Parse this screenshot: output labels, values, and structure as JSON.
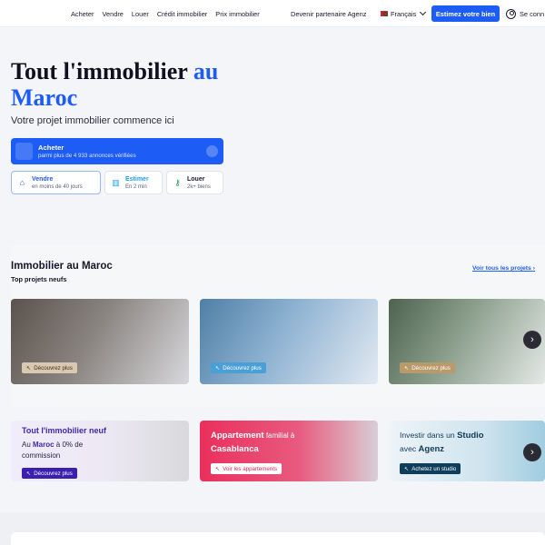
{
  "nav": {
    "links": [
      "Acheter",
      "Vendre",
      "Louer",
      "Crédit immobilier",
      "Prix immobilier"
    ],
    "partner": "Devenir partenaire Agenz",
    "language": "Français",
    "estimate_button": "Estimez votre bien",
    "login": "Se conn"
  },
  "hero": {
    "title_main": "Tout l'immobilier ",
    "title_accent_1": "au",
    "title_accent_2": "Maroc",
    "subtitle": "Votre projet immobilier commence ici",
    "buy": {
      "label": "Acheter",
      "detail": "parmi plus de 4 933 annonces vérifiées"
    },
    "sell": {
      "label": "Vendre",
      "detail": "en moins de 40 jours"
    },
    "estimate": {
      "label": "Estimer",
      "detail": "En 2 min"
    },
    "rent": {
      "label": "Louer",
      "detail": "2k+ biens"
    }
  },
  "projects": {
    "title": "Immobilier au Maroc",
    "subtitle": "Top projets neufs",
    "see_all": "Voir tous les projets",
    "cards": [
      {
        "cta": "Découvrez plus"
      },
      {
        "cta": "Découvrez plus"
      },
      {
        "cta": "Découvrez plus"
      }
    ]
  },
  "promos": {
    "new": {
      "headline": "Tout l'immobilier neuf",
      "line1_pre": "Au ",
      "line1_bold": "Maroc",
      "line1_post": " à 0% de",
      "line2": "commission",
      "cta": "Découvrez plus"
    },
    "family": {
      "headline_bold": "Appartement",
      "headline_rest": " familial à",
      "city": "Casablanca",
      "cta": "Voir les appartements"
    },
    "studio": {
      "line1_pre": "Investir dans un ",
      "line1_bold": "Studio",
      "line2_pre": "avec ",
      "line2_bold": "Agenz",
      "cta": "Achetez un studio"
    }
  },
  "colors": {
    "primary": "#1d5cf5",
    "promo_purple": "#3f2aa8",
    "promo_pink": "#ea2f5c",
    "promo_navy": "#0e3e5c"
  }
}
